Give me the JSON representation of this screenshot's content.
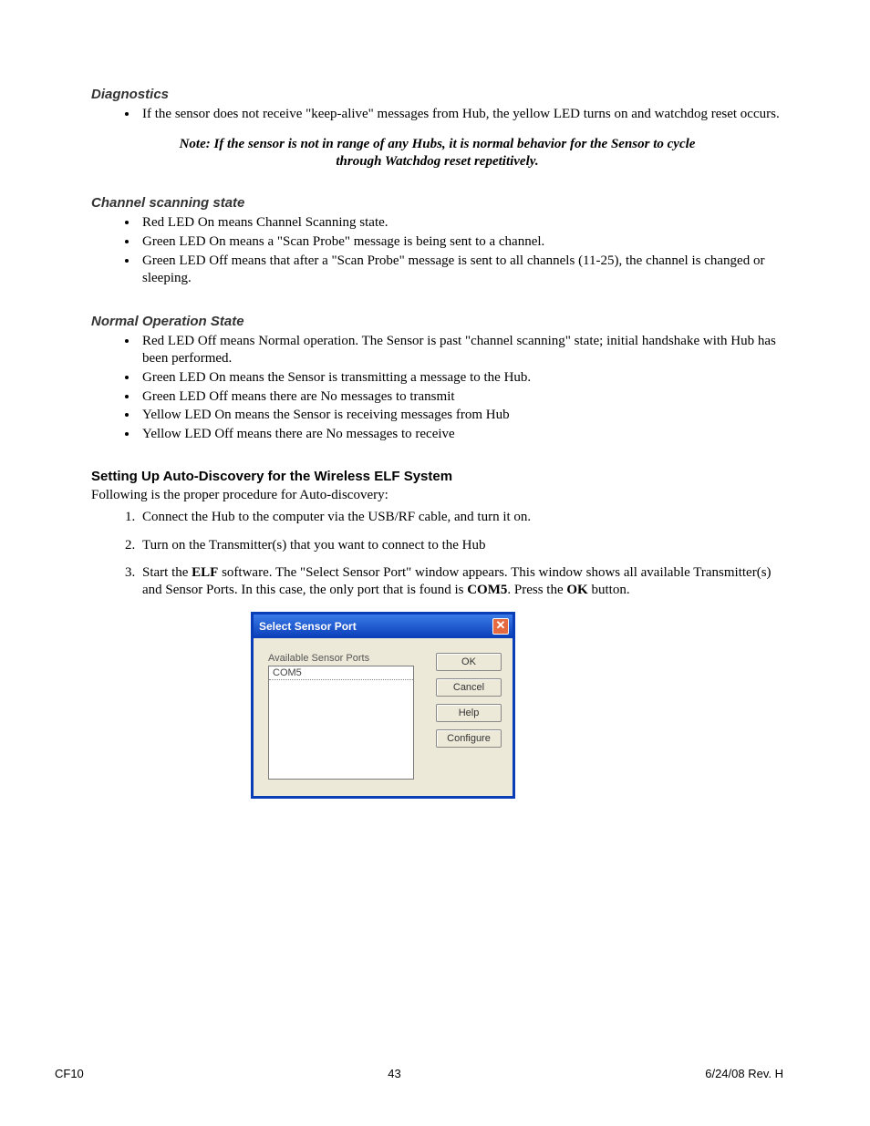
{
  "sections": {
    "diagnostics": {
      "title": "Diagnostics",
      "bullets": [
        "If the sensor does not receive \"keep-alive\" messages from Hub, the yellow LED turns on and watchdog reset occurs."
      ],
      "note": "Note: If the sensor is not in range of any Hubs, it is normal behavior for the Sensor to cycle through Watchdog reset repetitively."
    },
    "channel": {
      "title": "Channel scanning state",
      "bullets": [
        "Red LED On means Channel Scanning state.",
        "Green LED On means a \"Scan Probe\" message is being sent to a channel.",
        "Green LED Off means that after a \"Scan Probe\" message is sent to all channels (11-25), the channel is changed or sleeping."
      ]
    },
    "normal": {
      "title": "Normal Operation State",
      "bullets": [
        "Red LED Off means Normal operation. The Sensor is past \"channel scanning\" state; initial handshake with Hub has been performed.",
        "Green LED On means the Sensor is transmitting a message to the Hub.",
        "Green LED Off means there are No messages to transmit",
        "Yellow LED On means the Sensor is receiving messages from Hub",
        "Yellow LED Off means there are No messages to receive"
      ]
    },
    "autodisc": {
      "title": "Setting Up Auto-Discovery for the Wireless ELF System",
      "intro": "Following is the proper procedure for Auto-discovery:",
      "steps": {
        "s1": "Connect the Hub to the computer via the USB/RF cable, and turn it on.",
        "s2": "Turn on the Transmitter(s) that you want to connect to the Hub",
        "s3_a": "Start the ",
        "s3_b": "ELF",
        "s3_c": " software. The \"Select Sensor Port\" window appears. This window shows all available Transmitter(s) and Sensor Ports. In this case, the only port that is found is ",
        "s3_d": "COM5",
        "s3_e": ". Press the ",
        "s3_f": "OK",
        "s3_g": " button."
      }
    }
  },
  "dialog": {
    "title": "Select Sensor Port",
    "close": "✕",
    "label": "Available Sensor Ports",
    "item": "COM5",
    "buttons": {
      "ok": "OK",
      "cancel": "Cancel",
      "help": "Help",
      "configure": "Configure"
    }
  },
  "footer": {
    "left": "CF10",
    "center": "43",
    "right": "6/24/08 Rev. H"
  }
}
